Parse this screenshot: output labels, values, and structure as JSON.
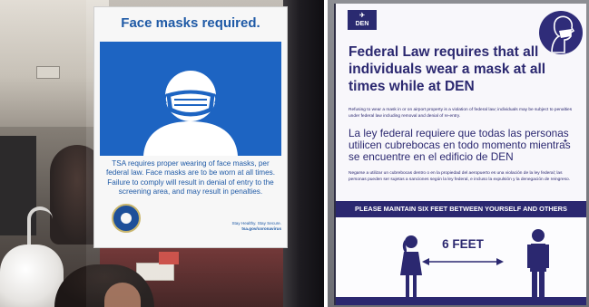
{
  "left_sign": {
    "title": "Face masks required.",
    "body": "TSA requires proper wearing of face masks, per federal law. Face masks are to be worn at all times. Failure to comply will result in denial of entry to the screening area, and may result in penalties.",
    "footer_line1": "Stay Healthy. Stay Secure.",
    "footer_line2": "tsa.gov/coronavirus"
  },
  "right_sign": {
    "logo": "DEN",
    "heading": "Federal Law requires that all individuals wear a mask at all times while at DEN",
    "english_notice": "Refusing to wear a mask in or on airport property is a violation of federal law; individuals may be subject to penalties under federal law including removal and denial of re-entry.",
    "spanish_heading": "La ley federal requiere que todas las personas utilicen cubrebocas en todo momento mientras se encuentre en el edificio de DEN",
    "spanish_notice": "Negarse a utilizar un cubrebocas dentro o en la propiedad del aeropuerto es una violación de la ley federal; las personas pueden ser sujetas a sanciones según la ley federal, e incluso la expulsión y la denegación de reingreso.",
    "band_text": "PLEASE MAINTAIN SIX FEET BETWEEN YOURSELF AND OTHERS",
    "distance_label": "6 FEET"
  },
  "colors": {
    "tsa_blue": "#1d64c2",
    "den_navy": "#2b2870"
  }
}
